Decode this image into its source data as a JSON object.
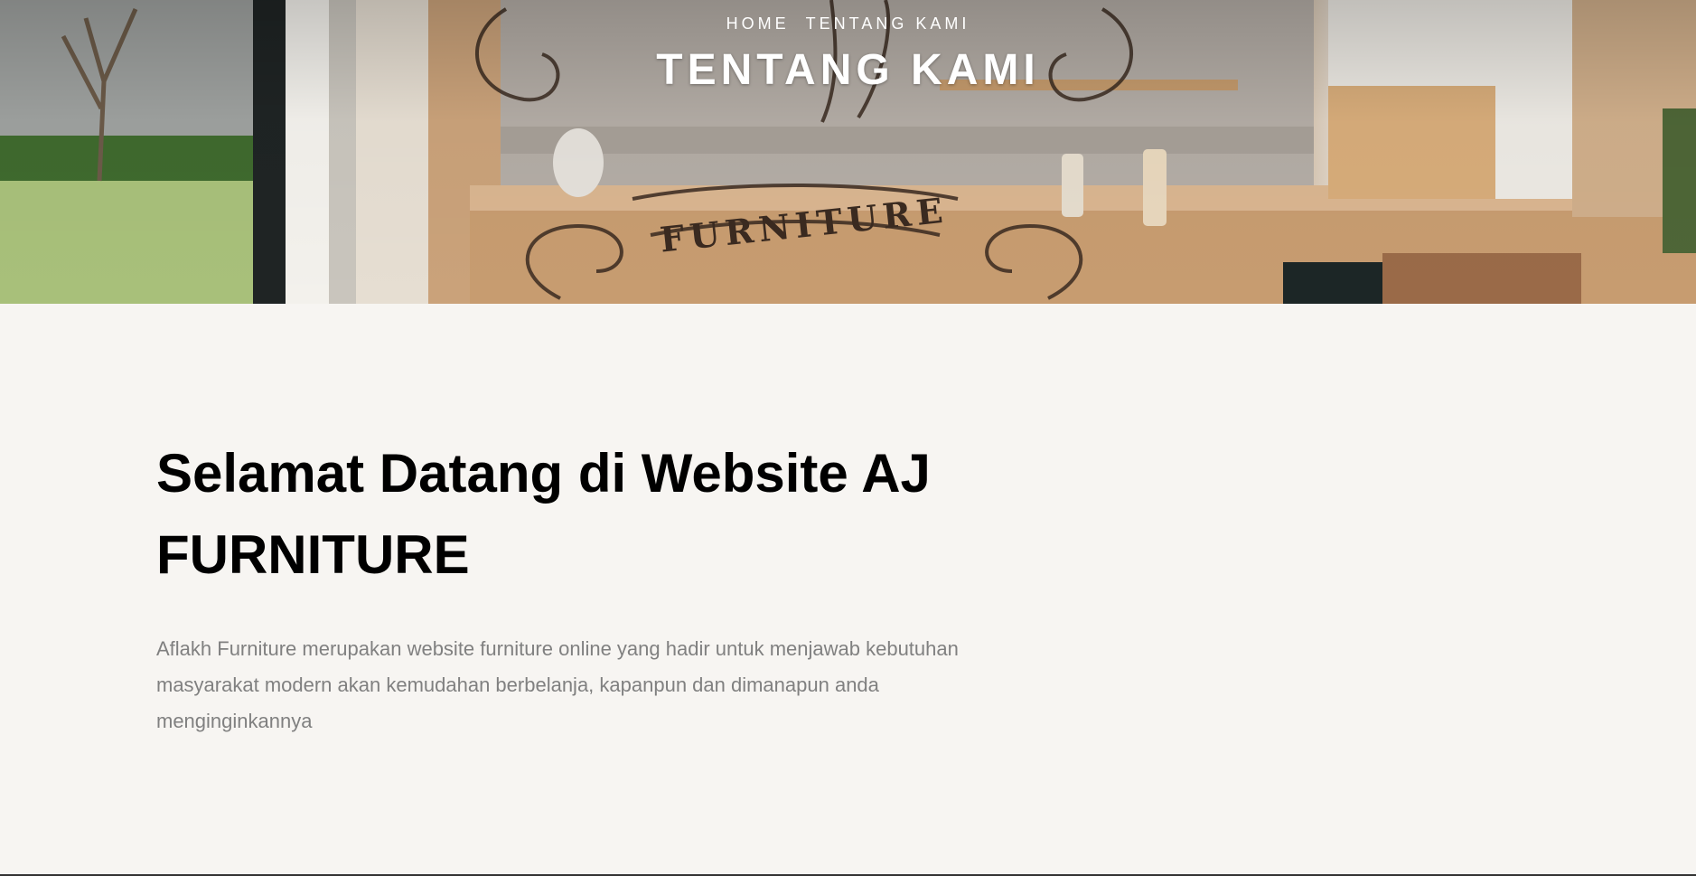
{
  "breadcrumb": {
    "home": "HOME",
    "current": "TENTANG KAMI"
  },
  "hero": {
    "title": "TENTANG KAMI",
    "logo_text": "FURNITURE"
  },
  "content": {
    "heading": "Selamat Datang di Website AJ FURNITURE",
    "paragraph": "Aflakh Furniture merupakan website furniture online yang hadir untuk menjawab kebutuhan masyarakat modern akan kemudahan berbelanja, kapanpun dan dimanapun anda menginginkannya"
  },
  "colors": {
    "background": "#f7f5f2",
    "heading": "#000000",
    "body_text": "#808080",
    "hero_text": "#ffffff"
  }
}
